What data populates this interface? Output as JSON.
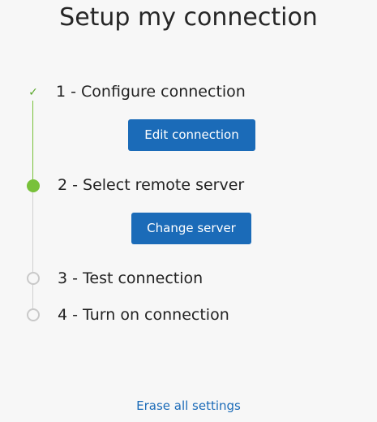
{
  "page": {
    "title": "Setup my connection"
  },
  "steps": [
    {
      "label": "1 - Configure connection",
      "status": "completed",
      "action_label": "Edit connection"
    },
    {
      "label": "2 - Select remote server",
      "status": "active",
      "action_label": "Change server"
    },
    {
      "label": "3 - Test connection",
      "status": "pending"
    },
    {
      "label": "4 - Turn on connection",
      "status": "pending"
    }
  ],
  "footer": {
    "erase_label": "Erase all settings"
  },
  "colors": {
    "accent_button": "#1b6bb8",
    "completed_green": "#78c13a",
    "pending_gray": "#c9c9c9",
    "background": "#f7f7f7"
  },
  "icons": {
    "completed": "check-icon",
    "active": "filled-circle",
    "pending": "empty-circle"
  }
}
